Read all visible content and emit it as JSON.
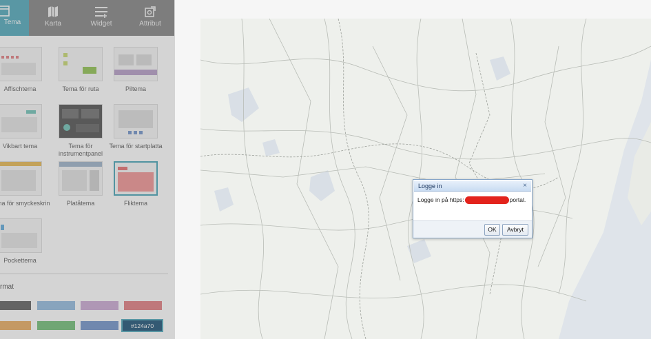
{
  "tabs": [
    {
      "label": "Tema",
      "icon": "layout-icon",
      "active": true
    },
    {
      "label": "Karta",
      "icon": "map-icon",
      "active": false
    },
    {
      "label": "Widget",
      "icon": "widget-icon",
      "active": false
    },
    {
      "label": "Attribut",
      "icon": "attribute-icon",
      "active": false
    }
  ],
  "themes": [
    {
      "label": "Affischtema"
    },
    {
      "label": "Tema för ruta"
    },
    {
      "label": "Piltema"
    },
    {
      "label": "Vikbart tema"
    },
    {
      "label": "Tema för instrumentpanel"
    },
    {
      "label": "Tema för startplatta"
    },
    {
      "label": "Tema för smyckeskrin"
    },
    {
      "label": "Platåtema"
    },
    {
      "label": "Fliktema",
      "selected": true
    },
    {
      "label": "Pockettema"
    }
  ],
  "format": {
    "heading": "rmat",
    "swatches": [
      "#5a5a5a",
      "#8fb8de",
      "#c9a6d2",
      "#e0787c",
      "#e7a85a",
      "#6cbb72",
      "#6c8fc8"
    ],
    "selected_value": "#124a70"
  },
  "dialog": {
    "title": "Logge in",
    "close_glyph": "×",
    "message_prefix": "Logge in på https:",
    "message_suffix": "portal.",
    "ok_label": "OK",
    "cancel_label": "Avbryt"
  },
  "colors": {
    "accent": "#4aa6b8",
    "tabbar": "#7f7f7f",
    "dialog_border": "#86a5c8"
  }
}
